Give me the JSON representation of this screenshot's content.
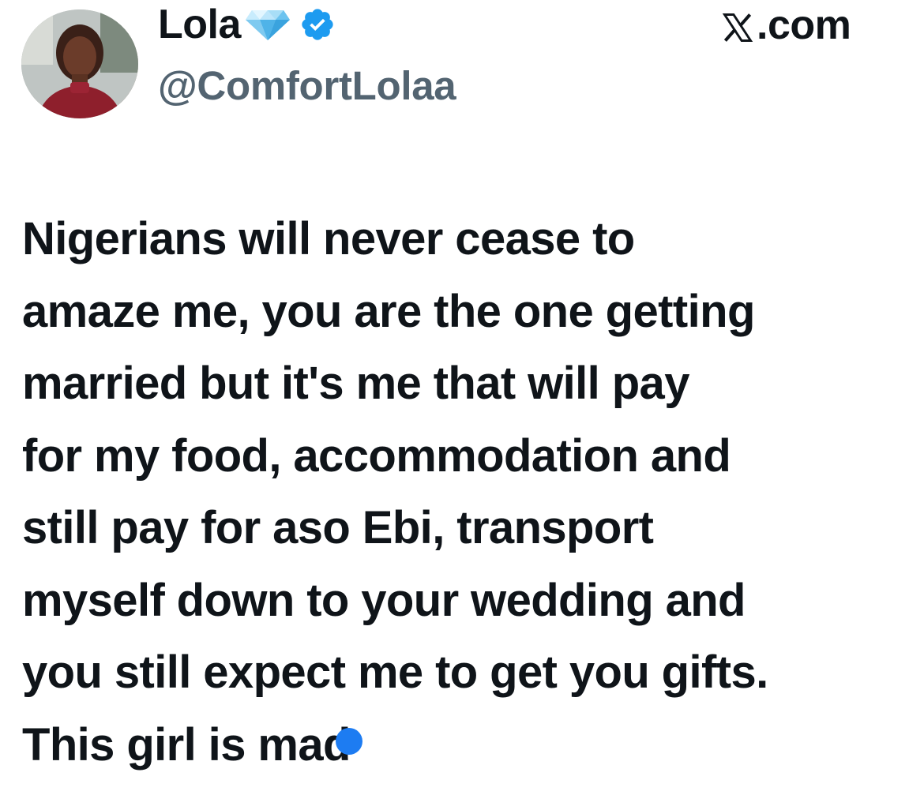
{
  "profile": {
    "display_name": "Lola",
    "handle": "@ComfortLolaa",
    "badges": [
      "gem-icon",
      "verified-icon"
    ]
  },
  "site": {
    "label": ".com",
    "logo": "x-logo-icon"
  },
  "tweet": {
    "lines": [
      "Nigerians will never cease to",
      "amaze me, you are the one getting",
      "married but it's me that will pay",
      "for my food, accommodation and",
      "still pay for aso Ebi, transport",
      "myself down to your wedding and",
      "you still expect me to get you gifts.",
      "This girl is mad"
    ]
  },
  "colors": {
    "text": "#0f1419",
    "handle": "#536471",
    "verified": "#1d9bf0",
    "touch_indicator": "#1d7cf2"
  }
}
